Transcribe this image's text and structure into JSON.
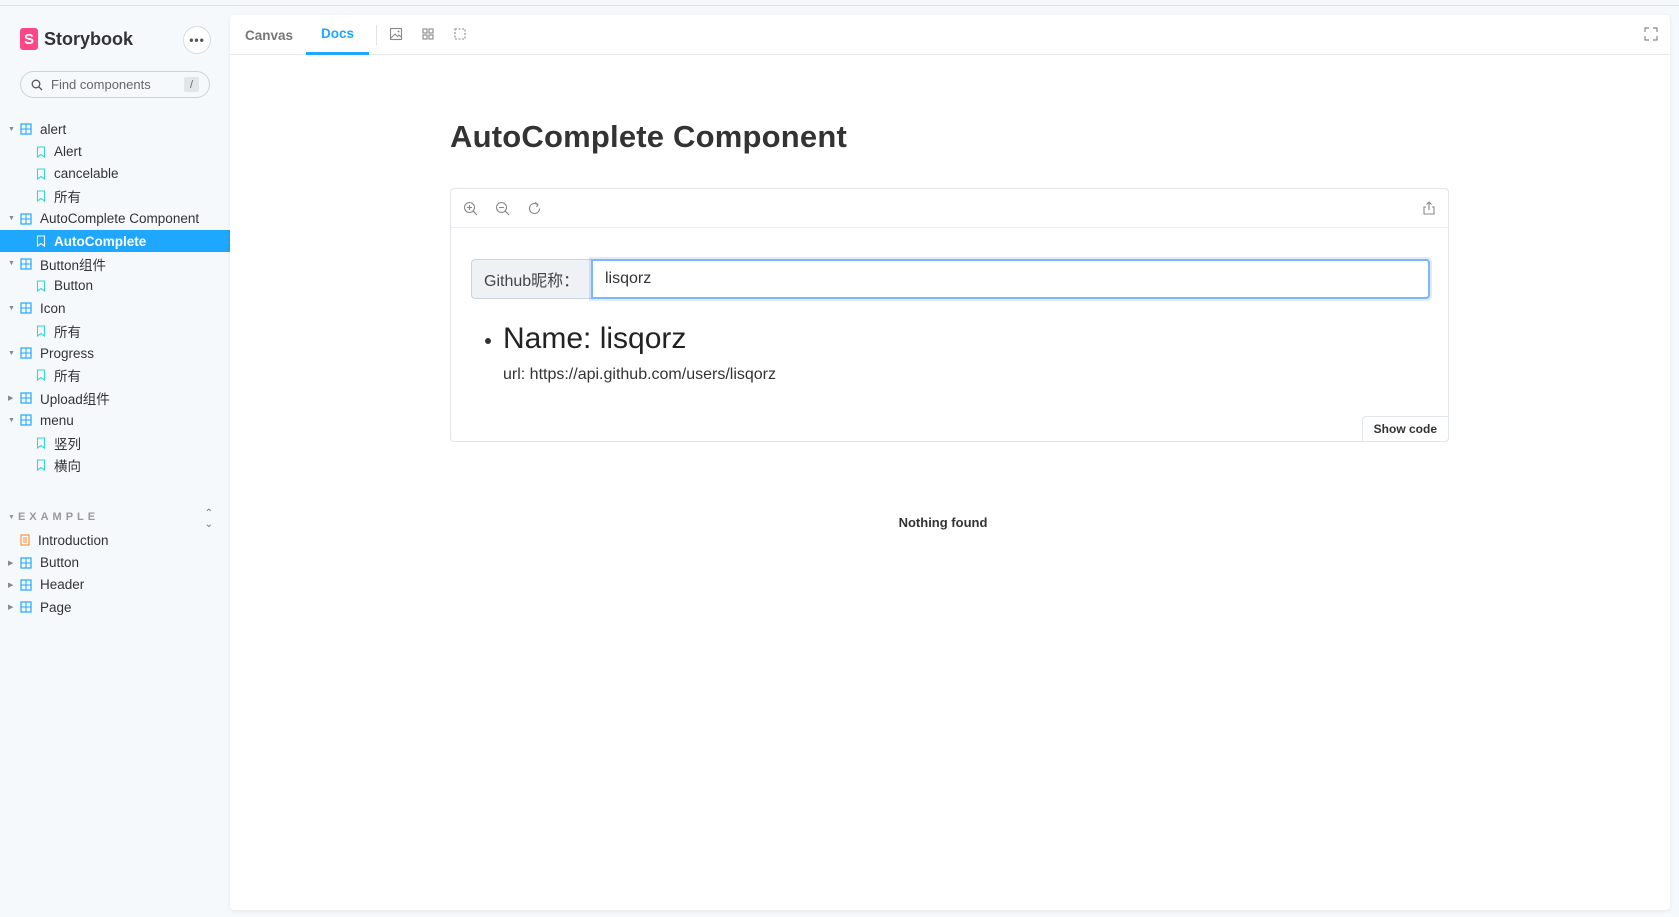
{
  "brand": {
    "name": "Storybook",
    "logo_letter": "S"
  },
  "sidebar": {
    "more_label": "•••",
    "search": {
      "placeholder": "Find components",
      "shortcut": "/"
    },
    "tree": [
      {
        "type": "group",
        "label": "alert",
        "expanded": true
      },
      {
        "type": "story",
        "label": "Alert"
      },
      {
        "type": "story",
        "label": "cancelable"
      },
      {
        "type": "story",
        "label": "所有"
      },
      {
        "type": "group",
        "label": "AutoComplete Component",
        "expanded": true
      },
      {
        "type": "story",
        "label": "AutoComplete",
        "active": true
      },
      {
        "type": "group",
        "label": "Button组件",
        "expanded": true
      },
      {
        "type": "story",
        "label": "Button"
      },
      {
        "type": "group",
        "label": "Icon",
        "expanded": true
      },
      {
        "type": "story",
        "label": "所有"
      },
      {
        "type": "group",
        "label": "Progress",
        "expanded": true
      },
      {
        "type": "story",
        "label": "所有"
      },
      {
        "type": "group",
        "label": "Upload组件",
        "expanded": false
      },
      {
        "type": "group",
        "label": "menu",
        "expanded": true
      },
      {
        "type": "story",
        "label": "竖列"
      },
      {
        "type": "story",
        "label": "横向"
      }
    ],
    "section": {
      "title": "EXAMPLE"
    },
    "example_tree": [
      {
        "type": "doc",
        "label": "Introduction"
      },
      {
        "type": "group",
        "label": "Button",
        "expanded": false
      },
      {
        "type": "group",
        "label": "Header",
        "expanded": false
      },
      {
        "type": "group",
        "label": "Page",
        "expanded": false
      }
    ]
  },
  "toolbar": {
    "tabs": [
      {
        "label": "Canvas",
        "active": false
      },
      {
        "label": "Docs",
        "active": true
      }
    ]
  },
  "doc": {
    "title": "AutoComplete Component",
    "input_label": "Github昵称：",
    "input_value": "lisqorz",
    "result": {
      "name": "Name: lisqorz",
      "url": "url: https://api.github.com/users/lisqorz"
    },
    "show_code_label": "Show code",
    "empty_message": "Nothing found"
  },
  "colors": {
    "accent": "#1ea7fd",
    "brand": "#ff4785",
    "sidebar_bg": "#f6f9fc"
  }
}
